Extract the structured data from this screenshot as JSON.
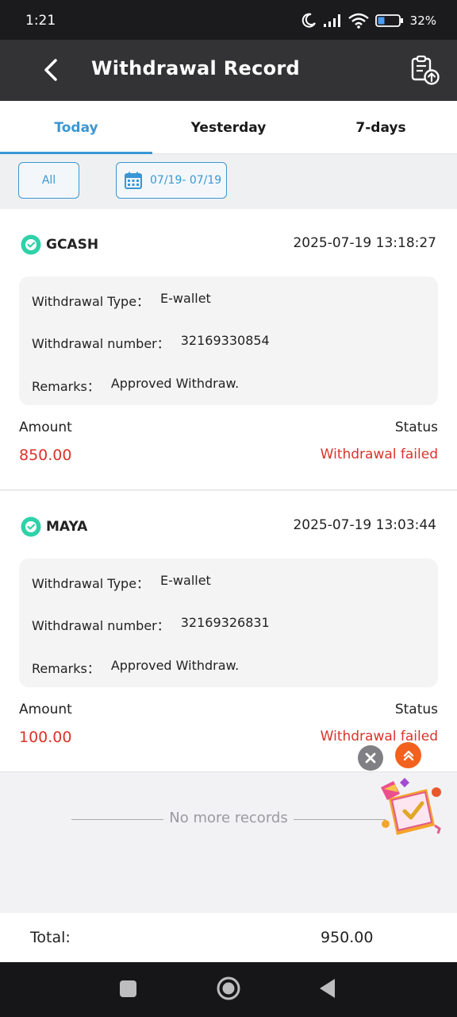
{
  "status_bar": {
    "time": "1:21",
    "battery": "32%"
  },
  "header": {
    "title": "Withdrawal Record"
  },
  "tabs": [
    {
      "label": "Today",
      "active": true
    },
    {
      "label": "Yesterday",
      "active": false
    },
    {
      "label": "7-days",
      "active": false
    }
  ],
  "filters": {
    "all_label": "All",
    "date_range": "07/19- 07/19"
  },
  "records": [
    {
      "channel": "GCASH",
      "datetime": "2025-07-19 13:18:27",
      "type_label": "Withdrawal Type：",
      "type_value": "E-wallet",
      "number_label": "Withdrawal number：",
      "number_value": "32169330854",
      "remarks_label": "Remarks：",
      "remarks_value": "Approved Withdraw.",
      "amount_label": "Amount",
      "amount_value": "850.00",
      "status_label": "Status",
      "status_value": "Withdrawal failed"
    },
    {
      "channel": "MAYA",
      "datetime": "2025-07-19 13:03:44",
      "type_label": "Withdrawal Type：",
      "type_value": "E-wallet",
      "number_label": "Withdrawal number：",
      "number_value": "32169326831",
      "remarks_label": "Remarks：",
      "remarks_value": "Approved Withdraw.",
      "amount_label": "Amount",
      "amount_value": "100.00",
      "status_label": "Status",
      "status_value": "Withdrawal failed"
    }
  ],
  "list_end": {
    "text": "No more records"
  },
  "total": {
    "label": "Total:",
    "value": "950.00"
  },
  "colors": {
    "accent": "#3a97d4",
    "error": "#d9332a",
    "header_bg": "#333335",
    "wallet_icon": "#2fd1a8"
  },
  "icons": [
    "back-arrow-icon",
    "record-upload-icon",
    "calendar-icon",
    "wallet-check-icon",
    "close-icon",
    "scroll-top-icon",
    "gift-box-icon"
  ]
}
